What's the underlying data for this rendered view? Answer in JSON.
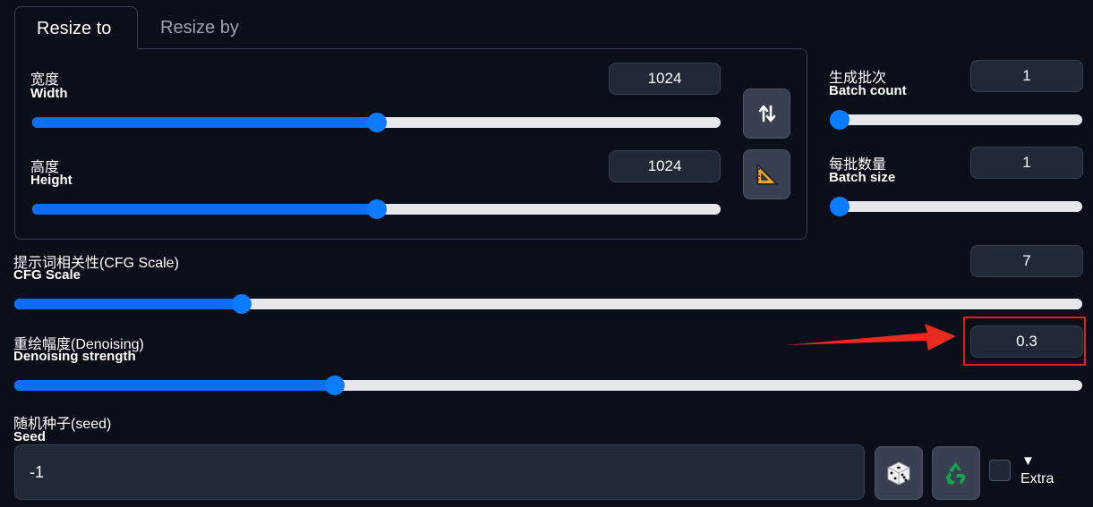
{
  "tabs": [
    {
      "label": "Resize to",
      "active": true
    },
    {
      "label": "Resize by",
      "active": false
    }
  ],
  "width": {
    "label_cn": "宽度",
    "label_en": "Width",
    "value": "1024",
    "slider_fraction": 0.5
  },
  "height": {
    "label_cn": "高度",
    "label_en": "Height",
    "value": "1024",
    "slider_fraction": 0.5
  },
  "swap_button": {
    "icon": "swap-vertical-icon"
  },
  "aspect_button": {
    "icon": "triangle-ruler-icon"
  },
  "batch_count": {
    "label_cn": "生成批次",
    "label_en": "Batch count",
    "value": "1",
    "slider_fraction": 0.0
  },
  "batch_size": {
    "label_cn": "每批数量",
    "label_en": "Batch size",
    "value": "1",
    "slider_fraction": 0.0
  },
  "cfg_scale": {
    "label_cn": "提示词相关性(CFG Scale)",
    "label_en": "CFG Scale",
    "value": "7",
    "slider_fraction": 0.2133
  },
  "denoising": {
    "label_cn": "重绘幅度(Denoising)",
    "label_en": "Denoising strength",
    "value": "0.3",
    "slider_fraction": 0.3,
    "highlighted": true
  },
  "seed": {
    "label_cn": "随机种子(seed)",
    "label_en": "Seed",
    "value": "-1"
  },
  "seed_buttons": {
    "random_icon": "dice-icon",
    "reuse_icon": "recycle-icon"
  },
  "extra": {
    "arrow": "▼",
    "label": "Extra",
    "checked": false
  },
  "colors": {
    "accent": "#0b7cff",
    "highlight": "#e02020",
    "background": "#0b0f19"
  }
}
